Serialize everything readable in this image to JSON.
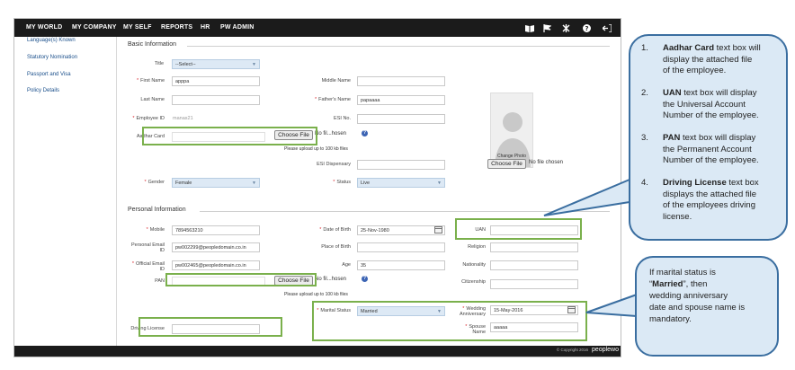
{
  "nav": {
    "items": [
      "MY WORLD",
      "MY COMPANY",
      "MY SELF",
      "REPORTS",
      "HR",
      "PW ADMIN"
    ],
    "icons": [
      "book-icon",
      "flag-icon",
      "tools-icon",
      "help-icon",
      "logout-icon"
    ]
  },
  "sidebar": {
    "items": [
      "Language(s) Known",
      "Statutory Nomination",
      "Passport and Visa",
      "Policy Details"
    ]
  },
  "basic": {
    "section_title": "Basic Information",
    "title_label": "Title",
    "title_value": "--Select--",
    "first_name_label": "First Name",
    "first_name_value": "apppa",
    "middle_name_label": "Middle Name",
    "middle_name_value": "",
    "last_name_label": "Last Name",
    "last_name_value": "",
    "fathers_name_label": "Father's Name",
    "fathers_name_value": "papaaaa",
    "employee_id_label": "Employee ID",
    "employee_id_value": "manas21",
    "esi_no_label": "ESI No.",
    "esi_no_value": "",
    "aadhar_label": "Aadhar Card",
    "choose_file": "Choose File",
    "no_file_short": "No fil...hosen",
    "upload_hint": "Please upload up to 100 kb files",
    "esi_dispensary_label": "ESI Dispensary",
    "esi_dispensary_value": "",
    "gender_label": "Gender",
    "gender_value": "Female",
    "status_label": "Status",
    "status_value": "Live",
    "change_photo_label": "Change Photo",
    "photo_choose_file": "Choose File",
    "photo_no_file": "No file chosen"
  },
  "personal": {
    "section_title": "Personal Information",
    "mobile_label": "Mobile",
    "mobile_value": "7894563210",
    "dob_label": "Date of Birth",
    "dob_value": "25-Nov-1980",
    "uan_label": "UAN",
    "uan_value": "",
    "personal_email_label_1": "Personal Email",
    "personal_email_label_2": "ID",
    "personal_email_value": "pw002299@peopledomain.co.in",
    "place_of_birth_label": "Place of Birth",
    "place_of_birth_value": "",
    "religion_label": "Religion",
    "religion_value": "",
    "official_email_label_1": "Official Email",
    "official_email_label_2": "ID",
    "official_email_value": "pw002465@peopledomain.co.in",
    "age_label": "Age",
    "age_value": "35",
    "nationality_label": "Nationality",
    "nationality_value": "",
    "pan_label": "PAN",
    "pan_choose_file": "Choose File",
    "pan_no_file": "No fil...hosen",
    "citizenship_label": "Citizenship",
    "citizenship_value": "",
    "pan_upload_hint": "Please upload up to 100 kb files",
    "marital_status_label": "Marital Status",
    "marital_status_value": "Married",
    "wedding_label_1": "Wedding",
    "wedding_label_2": "Anniversary",
    "wedding_value": "15-May-2016",
    "spouse_label_1": "Spouse",
    "spouse_label_2": "Name",
    "spouse_value": "aaaaa",
    "driving_license_label": "Driving License",
    "driving_license_value": ""
  },
  "footer": {
    "copyright": "© Copyright 2016",
    "brand": "peoplewo"
  },
  "callout1": {
    "items": [
      {
        "num": "1.",
        "bold": "Aadhar Card",
        "lines": [
          " text box will",
          "display the attached file",
          "of the employee."
        ]
      },
      {
        "num": "2.",
        "bold": "UAN",
        "lines": [
          " text box will display",
          "the Universal Account",
          "Number of the employee."
        ]
      },
      {
        "num": "3.",
        "bold": "PAN",
        "lines": [
          " text box will display",
          "the Permanent Account",
          "Number of the employee."
        ]
      },
      {
        "num": "4.",
        "bold": "Driving License",
        "lines": [
          " text box",
          "displays the attached file",
          "of the employees driving",
          "license."
        ]
      }
    ]
  },
  "callout2": {
    "line1": "If marital status is",
    "line2_pre": "“",
    "line2_bold": "Married",
    "line2_post": "”, then",
    "line3": "wedding anniversary",
    "line4": "date and spouse name is",
    "line5": "mandatory."
  },
  "colors": {
    "nav_bg": "#1b1b1b",
    "highlight_green": "#7ab04c",
    "callout_bg": "#dbe9f5",
    "callout_border": "#3a6ea0",
    "required_star": "#d9272e"
  }
}
